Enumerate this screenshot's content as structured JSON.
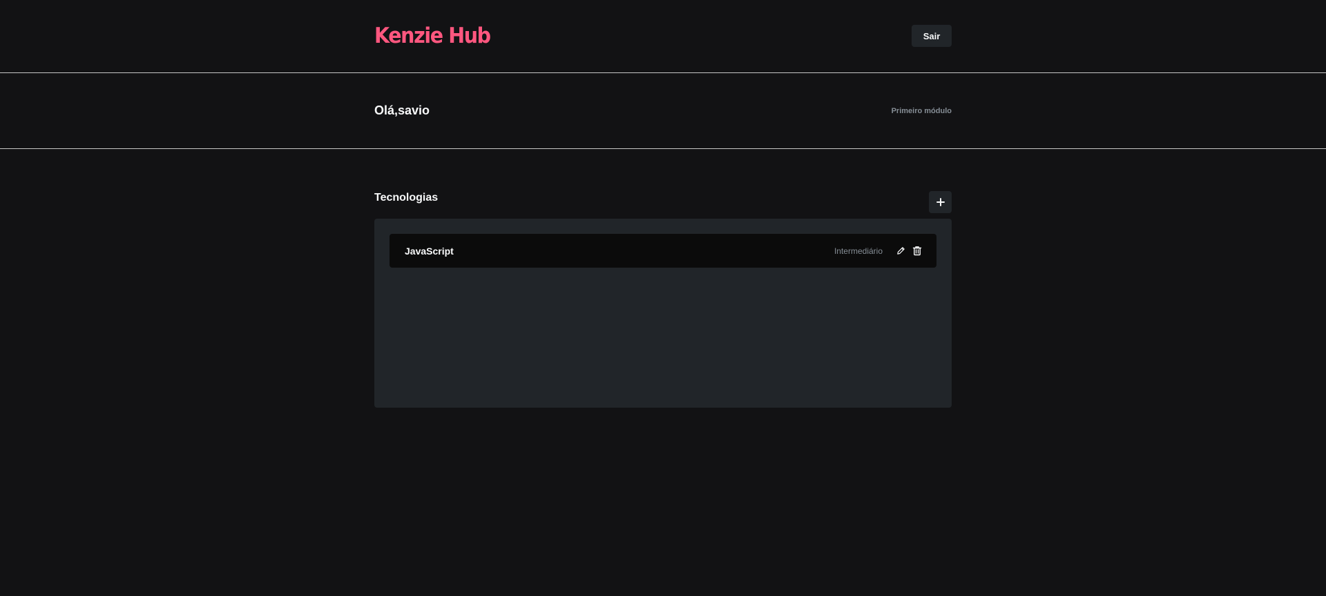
{
  "header": {
    "logo": "Kenzie Hub",
    "exit_label": "Sair"
  },
  "greeting": {
    "title": "Olá,savio",
    "module": "Primeiro módulo"
  },
  "techs": {
    "title": "Tecnologias",
    "add_icon": "plus-icon",
    "items": [
      {
        "name": "JavaScript",
        "status": "Intermediário",
        "edit_icon": "pencil-icon",
        "delete_icon": "trash-icon"
      }
    ]
  },
  "colors": {
    "background": "#121214",
    "brand": "#FF577F",
    "panel": "#212529",
    "card": "#0B0B0B",
    "muted_text": "#868E96",
    "text": "#F8F9FA"
  }
}
